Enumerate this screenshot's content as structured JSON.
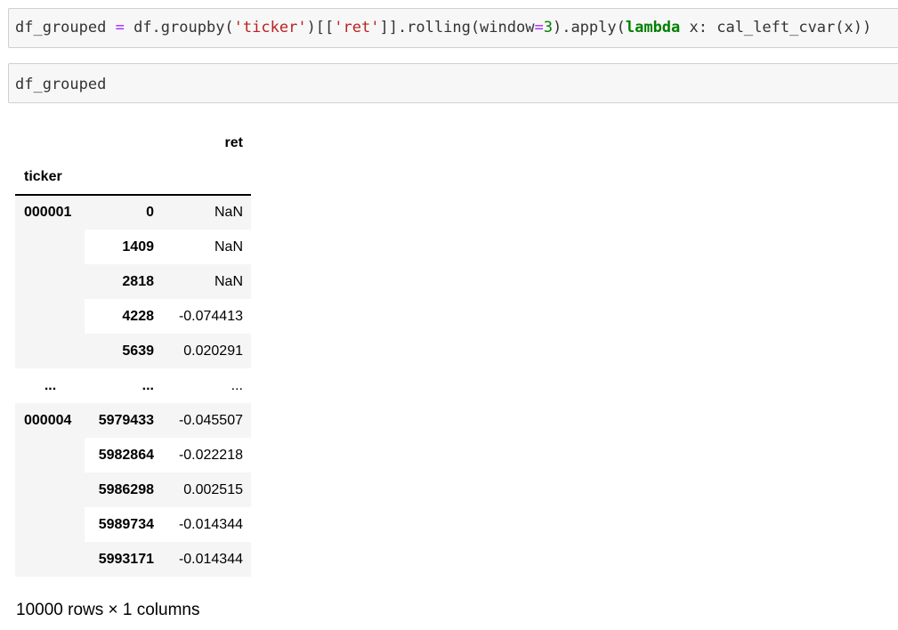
{
  "cells": [
    {
      "code_tokens": [
        {
          "t": "df_grouped ",
          "c": "plain"
        },
        {
          "t": "=",
          "c": "op"
        },
        {
          "t": " df.groupby(",
          "c": "plain"
        },
        {
          "t": "'ticker'",
          "c": "str"
        },
        {
          "t": ")[[",
          "c": "plain"
        },
        {
          "t": "'ret'",
          "c": "str"
        },
        {
          "t": "]].rolling(window",
          "c": "plain"
        },
        {
          "t": "=",
          "c": "op"
        },
        {
          "t": "3",
          "c": "num"
        },
        {
          "t": ").apply(",
          "c": "plain"
        },
        {
          "t": "lambda",
          "c": "kw"
        },
        {
          "t": " x: cal_left_cvar(x))",
          "c": "plain"
        }
      ]
    },
    {
      "code_tokens": [
        {
          "t": "df_grouped",
          "c": "plain"
        }
      ]
    }
  ],
  "dataframe": {
    "column_header": "ret",
    "index_name": "ticker",
    "rows": [
      {
        "level0": "000001",
        "level1": "0",
        "ret": "NaN"
      },
      {
        "level0": "",
        "level1": "1409",
        "ret": "NaN"
      },
      {
        "level0": "",
        "level1": "2818",
        "ret": "NaN"
      },
      {
        "level0": "",
        "level1": "4228",
        "ret": "-0.074413"
      },
      {
        "level0": "",
        "level1": "5639",
        "ret": "0.020291"
      },
      {
        "level0": "...",
        "level1": "...",
        "ret": "..."
      },
      {
        "level0": "000004",
        "level1": "5979433",
        "ret": "-0.045507"
      },
      {
        "level0": "",
        "level1": "5982864",
        "ret": "-0.022218"
      },
      {
        "level0": "",
        "level1": "5986298",
        "ret": "0.002515"
      },
      {
        "level0": "",
        "level1": "5989734",
        "ret": "-0.014344"
      },
      {
        "level0": "",
        "level1": "5993171",
        "ret": "-0.014344"
      }
    ],
    "shape_text": "10000 rows × 1 columns"
  }
}
